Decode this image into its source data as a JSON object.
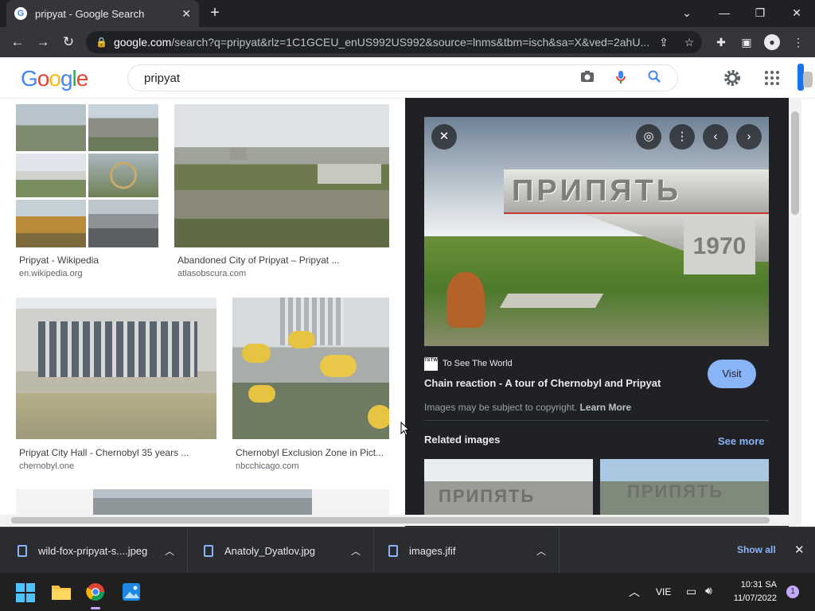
{
  "browser": {
    "tab_title": "pripyat - Google Search",
    "url_domain": "google.com",
    "url_path": "/search?q=pripyat&rlz=1C1GCEU_enUS992US992&source=lnms&tbm=isch&sa=X&ved=2ahU..."
  },
  "google": {
    "logo": "Google",
    "query": "pripyat"
  },
  "results": [
    {
      "title": "Pripyat - Wikipedia",
      "source": "en.wikipedia.org"
    },
    {
      "title": "Abandoned City of Pripyat – Pripyat ...",
      "source": "atlasobscura.com"
    },
    {
      "title": "Pripyat City Hall - Chernobyl 35 years ...",
      "source": "chernobyl.one"
    },
    {
      "title": "Chernobyl Exclusion Zone in Pict...",
      "source": "nbcchicago.com"
    }
  ],
  "preview": {
    "sign_text": "ПРИПЯТЬ",
    "sign_year": "1970",
    "source_badge": "TSTW",
    "source_name": "To See The World",
    "title": "Chain reaction - A tour of Chernobyl and Pripyat",
    "visit_label": "Visit",
    "copyright_text": "Images may be subject to copyright.",
    "learn_more": "Learn More",
    "related_heading": "Related images",
    "see_more": "See more",
    "related_sign": "ПРИПЯТЬ"
  },
  "downloads": {
    "items": [
      "wild-fox-pripyat-s....jpeg",
      "Anatoly_Dyatlov.jpg",
      "images.jfif"
    ],
    "show_all": "Show all"
  },
  "taskbar": {
    "language": "VIE",
    "time": "10:31 SA",
    "date": "11/07/2022",
    "notification_count": "1"
  },
  "colors": {
    "accent": "#8ab4f8",
    "google_blue": "#4285f4",
    "google_red": "#ea4335",
    "google_yellow": "#fbbc05",
    "google_green": "#34a853"
  }
}
